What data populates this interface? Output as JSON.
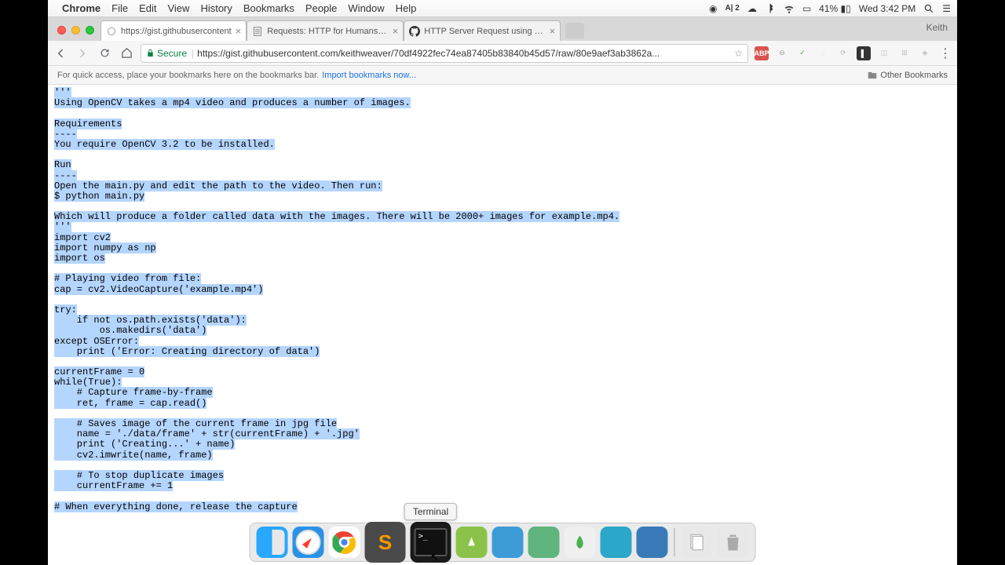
{
  "menubar": {
    "app": "Chrome",
    "items": [
      "File",
      "Edit",
      "View",
      "History",
      "Bookmarks",
      "People",
      "Window",
      "Help"
    ],
    "battery": "41%",
    "clock": "Wed 3:42 PM"
  },
  "tabs": [
    {
      "title": "https://gist.githubusercontent",
      "active": true,
      "favicon": "globe"
    },
    {
      "title": "Requests: HTTP for Humans —",
      "active": false,
      "favicon": "doc"
    },
    {
      "title": "HTTP Server Request using Re",
      "active": false,
      "favicon": "github"
    }
  ],
  "profile": "Keith",
  "omnibox": {
    "secure_label": "Secure",
    "url": "https://gist.githubusercontent.com/keithweaver/70df4922fec74ea87405b83840b45d57/raw/80e9aef3ab3862a..."
  },
  "bookmark_bar": {
    "hint": "For quick access, place your bookmarks here on the bookmarks bar.",
    "import": "Import bookmarks now...",
    "other": "Other Bookmarks"
  },
  "code_lines": [
    {
      "t": "'''",
      "hl": true
    },
    {
      "t": "Using OpenCV takes a mp4 video and produces a number of images.",
      "hl": true
    },
    {
      "t": "",
      "hl": false
    },
    {
      "t": "Requirements",
      "hl": true
    },
    {
      "t": "----",
      "hl": true
    },
    {
      "t": "You require OpenCV 3.2 to be installed.",
      "hl": true
    },
    {
      "t": "",
      "hl": false
    },
    {
      "t": "Run",
      "hl": true
    },
    {
      "t": "----",
      "hl": true
    },
    {
      "t": "Open the main.py and edit the path to the video. Then run:",
      "hl": true
    },
    {
      "t": "$ python main.py",
      "hl": true
    },
    {
      "t": "",
      "hl": false
    },
    {
      "t": "Which will produce a folder called data with the images. There will be 2000+ images for example.mp4.",
      "hl": true
    },
    {
      "t": "'''",
      "hl": true
    },
    {
      "t": "import cv2",
      "hl": true
    },
    {
      "t": "import numpy as np",
      "hl": true
    },
    {
      "t": "import os",
      "hl": true
    },
    {
      "t": "",
      "hl": false
    },
    {
      "t": "# Playing video from file:",
      "hl": true
    },
    {
      "t": "cap = cv2.VideoCapture('example.mp4')",
      "hl": true
    },
    {
      "t": "",
      "hl": false
    },
    {
      "t": "try:",
      "hl": true
    },
    {
      "t": "    if not os.path.exists('data'):",
      "hl": true
    },
    {
      "t": "        os.makedirs('data')",
      "hl": true
    },
    {
      "t": "except OSError:",
      "hl": true
    },
    {
      "t": "    print ('Error: Creating directory of data')",
      "hl": true
    },
    {
      "t": "",
      "hl": false
    },
    {
      "t": "currentFrame = 0",
      "hl": true
    },
    {
      "t": "while(True):",
      "hl": true
    },
    {
      "t": "    # Capture frame-by-frame",
      "hl": true
    },
    {
      "t": "    ret, frame = cap.read()",
      "hl": true
    },
    {
      "t": "",
      "hl": false
    },
    {
      "t": "    # Saves image of the current frame in jpg file",
      "hl": true
    },
    {
      "t": "    name = './data/frame' + str(currentFrame) + '.jpg'",
      "hl": true
    },
    {
      "t": "    print ('Creating...' + name)",
      "hl": true
    },
    {
      "t": "    cv2.imwrite(name, frame)",
      "hl": true
    },
    {
      "t": "",
      "hl": false
    },
    {
      "t": "    # To stop duplicate images",
      "hl": true
    },
    {
      "t": "    currentFrame += 1",
      "hl": true
    },
    {
      "t": "",
      "hl": false
    },
    {
      "t": "# When everything done, release the capture",
      "hl": true
    }
  ],
  "dock": {
    "tooltip": "Terminal",
    "items": [
      {
        "name": "finder",
        "bg": "#2aa7ff"
      },
      {
        "name": "safari",
        "bg": "#2a92e6"
      },
      {
        "name": "chrome",
        "bg": "#fff"
      },
      {
        "name": "sublime",
        "bg": "#4a4a4a",
        "big": true
      },
      {
        "name": "terminal",
        "bg": "#1a1a1a",
        "big": true,
        "tooltip": true
      },
      {
        "name": "android-studio",
        "bg": "#8bc34a"
      },
      {
        "name": "xcode",
        "bg": "#3d9bd8"
      },
      {
        "name": "atom",
        "bg": "#5fb57d"
      },
      {
        "name": "mongo",
        "bg": "#f0f0f0"
      },
      {
        "name": "preview",
        "bg": "#2aa7c9"
      },
      {
        "name": "quicktime",
        "bg": "#3a7ab8"
      }
    ],
    "items_right": [
      {
        "name": "documents",
        "bg": "#e8e8e8"
      },
      {
        "name": "trash",
        "bg": "#e8e8e8"
      }
    ]
  }
}
